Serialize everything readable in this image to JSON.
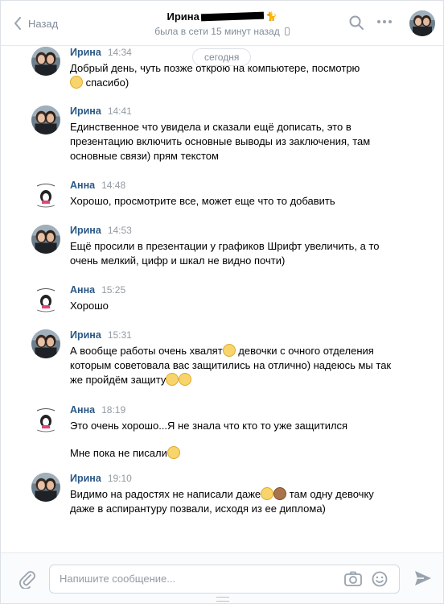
{
  "header": {
    "back_label": "Назад",
    "peer_name": "Ирина",
    "peer_status": "была в сети 15 минут назад",
    "icons": {
      "back": "chevron-left-icon",
      "search": "search-icon",
      "more": "more-dots-icon",
      "phone": "mobile-phone-icon"
    }
  },
  "feed": {
    "date_label": "сегодня",
    "messages": [
      {
        "author": "Ирина",
        "time": "14:34",
        "lines": [
          [
            "Добрый день, чуть позже открою на компьютере, посмотрю "
          ],
          [
            "",
            "спасибо)"
          ]
        ]
      },
      {
        "author": "Ирина",
        "time": "14:41",
        "lines": [
          [
            "Единственное что увидела и сказали ещё дописать, это в презентацию включить основные выводы из заключения, там основные связи) прям текстом"
          ]
        ]
      },
      {
        "author": "Анна",
        "time": "14:48",
        "lines": [
          [
            "Хорошо, просмотрите все, может еще что то добавить"
          ]
        ]
      },
      {
        "author": "Ирина",
        "time": "14:53",
        "lines": [
          [
            "Ещё просили в презентации у графиков Шрифт увеличить, а то очень мелкий, цифр и шкал не видно почти)"
          ]
        ]
      },
      {
        "author": "Анна",
        "time": "15:25",
        "lines": [
          [
            "Хорошо"
          ]
        ]
      },
      {
        "author": "Ирина",
        "time": "15:31",
        "lines": [
          [
            "А вообще работы очень хвалят",
            " девочки с очного отделения которым советовала вас защитились на отлично) надеюсь мы так же пройдём защиту"
          ]
        ]
      },
      {
        "author": "Анна",
        "time": "18:19",
        "lines": [
          [
            "Это очень хорошо...Я не знала что кто то уже защитился"
          ],
          [
            "Мне пока не писали"
          ]
        ]
      },
      {
        "author": "Ирина",
        "time": "19:10",
        "lines": [
          [
            "Видимо на радостях не написали даже",
            " там одну девочку даже в аспирантуру позвали, исходя из ее диплома)"
          ]
        ]
      }
    ]
  },
  "composer": {
    "placeholder": "Напишите сообщение...",
    "icons": {
      "attach": "paperclip-icon",
      "camera": "camera-icon",
      "emoji": "smile-icon",
      "send": "send-icon"
    }
  },
  "colors": {
    "author": "#2a5885",
    "muted": "#818c99",
    "background": "#ffffff"
  }
}
